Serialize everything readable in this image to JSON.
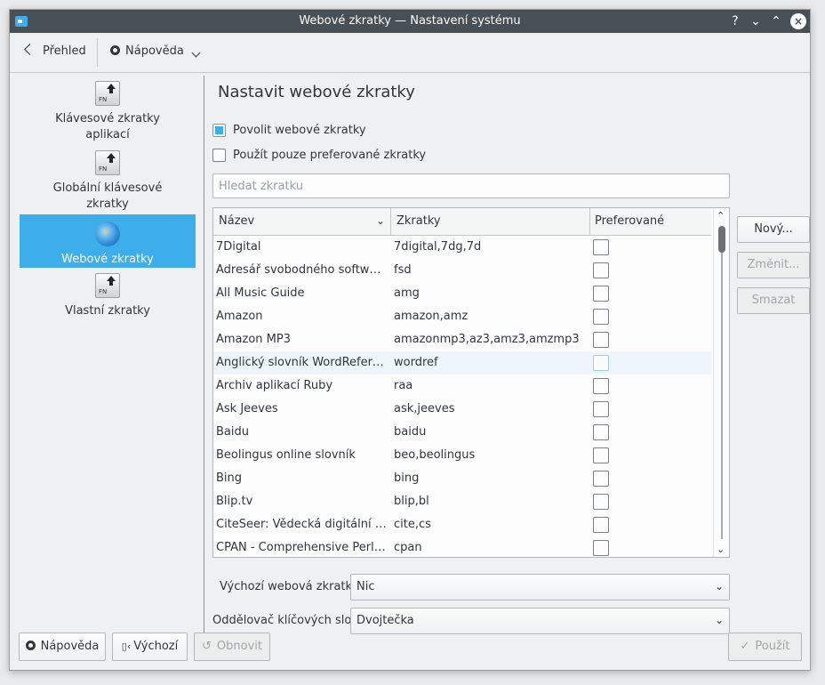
{
  "window": {
    "title": "Webové zkratky  — Nastavení systému"
  },
  "titlebar": {
    "help_glyph": "?",
    "minimize_glyph": "⌄",
    "maximize_glyph": "⌃",
    "close_glyph": "×"
  },
  "toolbar": {
    "back_label": "Přehled",
    "help_label": "Nápověda"
  },
  "sidebar": {
    "items": [
      {
        "label": "Klávesové zkratky aplikací",
        "icon": "fn-key-icon",
        "selected": false
      },
      {
        "label": "Globální klávesové zkratky",
        "icon": "fn-key-icon",
        "selected": false
      },
      {
        "label": "Webové zkratky",
        "icon": "globe-icon",
        "selected": true
      },
      {
        "label": "Vlastní zkratky",
        "icon": "fn-key-icon",
        "selected": false
      }
    ]
  },
  "main": {
    "title": "Nastavit webové zkratky",
    "enable_checkbox": {
      "label": "Povolit webové zkratky",
      "checked": true
    },
    "preferred_checkbox": {
      "label": "Použít pouze preferované zkratky",
      "checked": false
    },
    "search": {
      "placeholder": "Hledat zkratku",
      "value": ""
    },
    "table": {
      "columns": [
        "Název",
        "Zkratky",
        "Preferované"
      ],
      "rows": [
        {
          "name": "7Digital",
          "keys": "7digital,7dg,7d",
          "preferred": false
        },
        {
          "name": "Adresář svobodného softwaru F...",
          "keys": "fsd",
          "preferred": false
        },
        {
          "name": "All Music Guide",
          "keys": "amg",
          "preferred": false
        },
        {
          "name": "Amazon",
          "keys": "amazon,amz",
          "preferred": false
        },
        {
          "name": "Amazon MP3",
          "keys": "amazonmp3,az3,amz3,amzmp3",
          "preferred": false
        },
        {
          "name": "Anglický slovník WordReferenc...",
          "keys": "wordref",
          "preferred": false,
          "hover": true
        },
        {
          "name": "Archiv aplikací Ruby",
          "keys": "raa",
          "preferred": false
        },
        {
          "name": "Ask Jeeves",
          "keys": "ask,jeeves",
          "preferred": false
        },
        {
          "name": "Baidu",
          "keys": "baidu",
          "preferred": false
        },
        {
          "name": "Beolingus online slovník",
          "keys": "beo,beolingus",
          "preferred": false
        },
        {
          "name": "Bing",
          "keys": "bing",
          "preferred": false
        },
        {
          "name": "Blip.tv",
          "keys": "blip,bl",
          "preferred": false
        },
        {
          "name": "CiteSeer: Vědecká digitální knih...",
          "keys": "cite,cs",
          "preferred": false
        },
        {
          "name": "CPAN - Comprehensive Perl Arc...",
          "keys": "cpan",
          "preferred": false
        }
      ]
    },
    "buttons": {
      "new": "Nový...",
      "edit": "Změnit...",
      "delete": "Smazat"
    },
    "default_shortcut": {
      "label": "Výchozí webová zkratka:",
      "value": "Nic"
    },
    "keyword_separator": {
      "label": "Oddělovač klíčových slov:",
      "value": "Dvojtečka"
    }
  },
  "footer": {
    "help": "Nápověda",
    "defaults": "Výchozí",
    "reset": "Obnovit",
    "apply": "Použít"
  },
  "colors": {
    "accent": "#3daee9",
    "titlebar": "#475057",
    "background": "#eff0f1"
  }
}
